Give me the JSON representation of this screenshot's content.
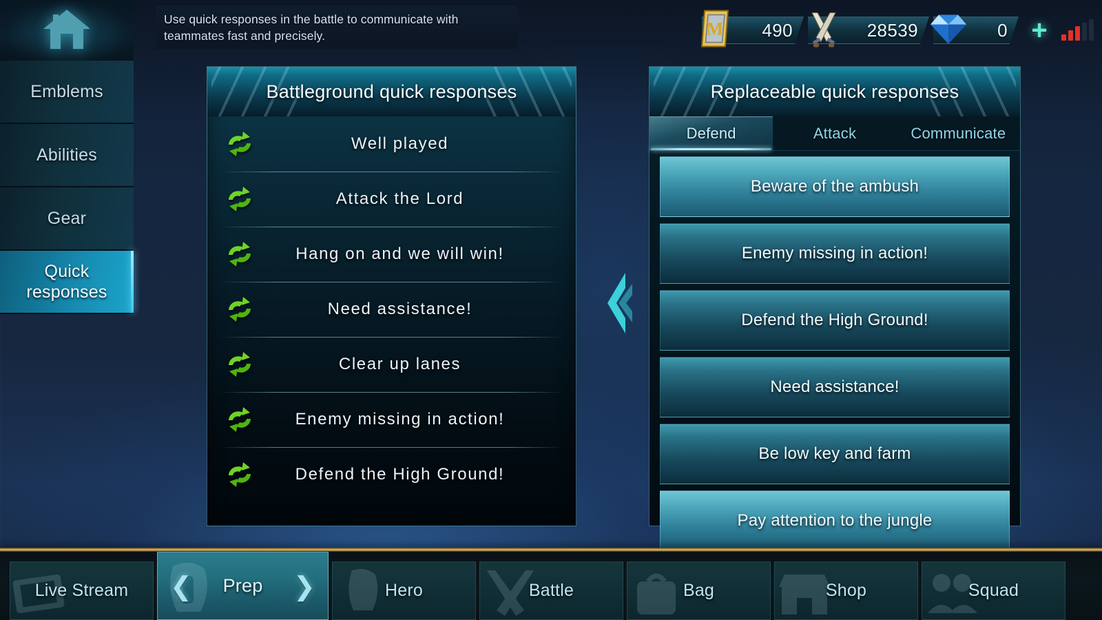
{
  "topbar": {
    "home_icon": "home-icon",
    "tooltip": "Use quick responses in the battle to communicate with teammates fast and precisely.",
    "currencies": [
      {
        "icon": "medal-token-icon",
        "value": "490"
      },
      {
        "icon": "crossed-swords-battle-points-icon",
        "value": "28539"
      },
      {
        "icon": "diamond-gem-icon",
        "value": "0"
      }
    ],
    "plus_label": "+",
    "signal_icon": "signal-bars-icon",
    "signal_bars_lit": 3,
    "signal_bars_total": 5,
    "signal_lit_color": "#e03226",
    "signal_dim_color": "#1e2b3d"
  },
  "sidebar": {
    "items": [
      {
        "label": "Emblems",
        "active": false
      },
      {
        "label": "Abilities",
        "active": false
      },
      {
        "label": "Gear",
        "active": false
      },
      {
        "label": "Quick",
        "label2": "responses",
        "active": true
      }
    ]
  },
  "left_panel": {
    "title": "Battleground quick responses",
    "row_icon": "swap-refresh-arrows-icon",
    "rows": [
      "Well played",
      "Attack the Lord",
      "Hang on and we will win!",
      "Need assistance!",
      "Clear up lanes",
      "Enemy missing in action!",
      "Defend the High Ground!"
    ]
  },
  "center": {
    "icon": "double-chevron-left-icon"
  },
  "right_panel": {
    "title": "Replaceable quick responses",
    "tabs": [
      {
        "label": "Defend",
        "active": true
      },
      {
        "label": "Attack",
        "active": false
      },
      {
        "label": "Communicate",
        "active": false
      }
    ],
    "items": [
      {
        "label": "Beware of the ambush",
        "highlighted": true
      },
      {
        "label": "Enemy missing in action!",
        "highlighted": false
      },
      {
        "label": "Defend the High Ground!",
        "highlighted": false
      },
      {
        "label": "Need assistance!",
        "highlighted": false
      },
      {
        "label": "Be low key and farm",
        "highlighted": false
      },
      {
        "label": "Pay attention to the jungle",
        "highlighted": true
      }
    ]
  },
  "bottom_nav": {
    "items": [
      {
        "label": "Live Stream",
        "active": false,
        "watermark": "tv-screen-icon"
      },
      {
        "label": "Prep",
        "active": true,
        "watermark": "helmet-icon"
      },
      {
        "label": "Hero",
        "active": false,
        "watermark": "hero-bust-icon"
      },
      {
        "label": "Battle",
        "active": false,
        "watermark": "crossed-swords-icon"
      },
      {
        "label": "Bag",
        "active": false,
        "watermark": "backpack-icon"
      },
      {
        "label": "Shop",
        "active": false,
        "watermark": "storefront-icon"
      },
      {
        "label": "Squad",
        "active": false,
        "watermark": "squad-banner-icon"
      }
    ],
    "arrow_left": "❮",
    "arrow_right": "❯"
  },
  "colors": {
    "accent_cyan": "#1ba5cc",
    "panel_border": "#82cde1",
    "green_icon": "#5ec918",
    "gold_divider": "#d8bd7e"
  }
}
